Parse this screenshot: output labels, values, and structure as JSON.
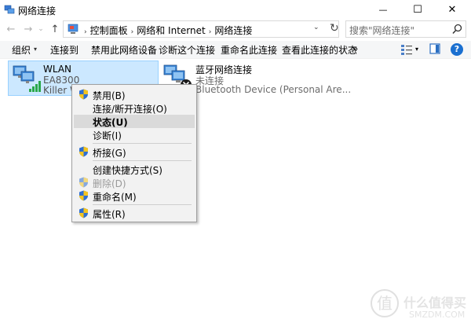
{
  "window": {
    "title": "网络连接",
    "minimize_glyph": "—",
    "maximize_glyph": "☐",
    "close_glyph": "✕"
  },
  "address": {
    "back_glyph": "←",
    "forward_glyph": "→",
    "recent_glyph": "⌄",
    "up_glyph": "↑",
    "crumbs": [
      "控制面板",
      "网络和 Internet",
      "网络连接"
    ],
    "crumb_separator": "›",
    "dropdown_glyph": "⌄",
    "refresh_glyph": "↻",
    "search_placeholder": "搜索\"网络连接\""
  },
  "toolbar": {
    "organize": "组织",
    "dropdown_glyph": "▾",
    "connect_to": "连接到",
    "disable_device": "禁用此网络设备",
    "diagnose": "诊断这个连接",
    "rename": "重命名此连接",
    "view_status": "查看此连接的状态",
    "more": "»",
    "help": "?"
  },
  "connections": [
    {
      "name": "WLAN",
      "line2": "EA8300",
      "line3": "Killer Wi"
    },
    {
      "name": "蓝牙网络连接",
      "line2": "未连接",
      "line3": "Bluetooth Device (Personal Are..."
    }
  ],
  "context_menu": [
    {
      "label": "禁用(B)",
      "shield": true,
      "highlighted": false,
      "disabled": false
    },
    {
      "label": "连接/断开连接(O)",
      "shield": false,
      "highlighted": false,
      "disabled": false
    },
    {
      "label": "状态(U)",
      "shield": false,
      "highlighted": true,
      "bold": true,
      "disabled": false
    },
    {
      "label": "诊断(I)",
      "shield": false,
      "highlighted": false,
      "disabled": false
    },
    {
      "label": "桥接(G)",
      "shield": true,
      "highlighted": false,
      "disabled": false
    },
    {
      "label": "创建快捷方式(S)",
      "shield": false,
      "highlighted": false,
      "disabled": false
    },
    {
      "label": "删除(D)",
      "shield": true,
      "highlighted": false,
      "disabled": true
    },
    {
      "label": "重命名(M)",
      "shield": true,
      "highlighted": false,
      "disabled": false
    },
    {
      "label": "属性(R)",
      "shield": true,
      "highlighted": false,
      "disabled": false
    }
  ],
  "watermark": {
    "badge": "值",
    "text": "什么值得买",
    "sub": "SMZDM.COM"
  },
  "colors": {
    "selection_bg": "#cce8ff",
    "selection_border": "#99d1ff",
    "help_blue": "#1a6fd0",
    "signal_green": "#2aa84a"
  }
}
